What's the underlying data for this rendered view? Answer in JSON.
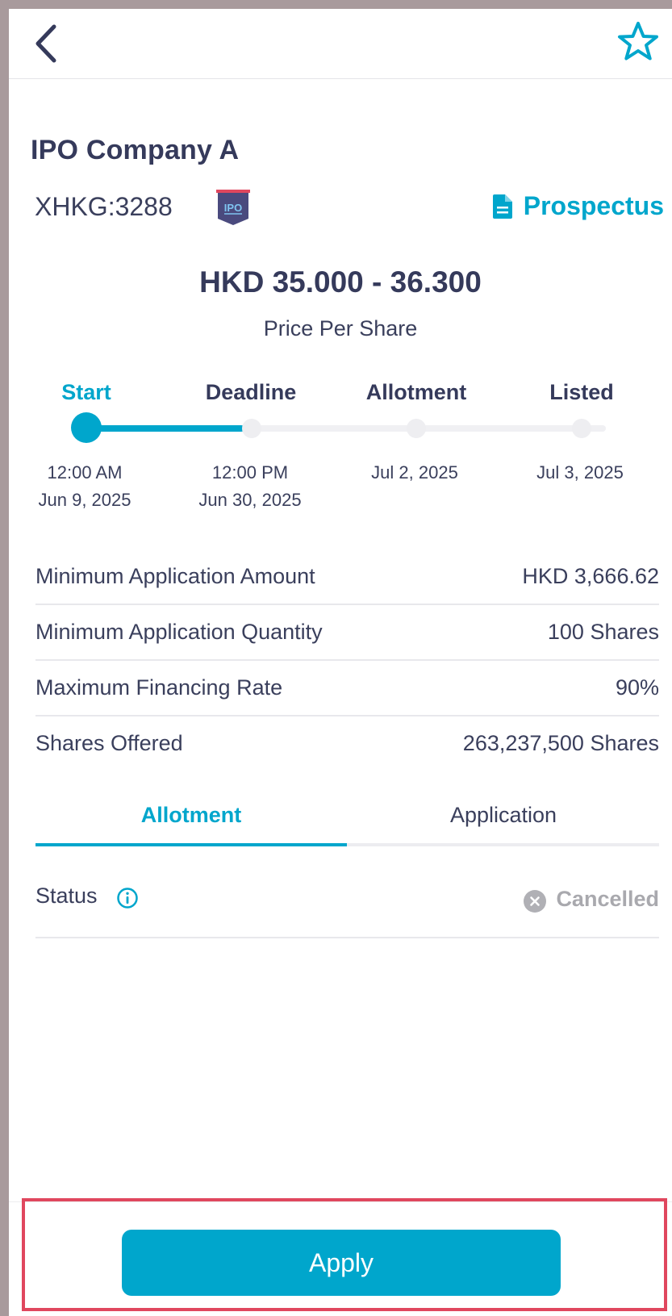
{
  "header": {
    "back_icon": "chevron-left-icon",
    "favorite_icon": "star-outline-icon"
  },
  "company": {
    "name": "IPO Company A",
    "ticker": "XHKG:3288",
    "badge_text": "IPO",
    "prospectus_label": "Prospectus"
  },
  "price": {
    "range": "HKD 35.000 - 36.300",
    "caption": "Price Per Share"
  },
  "timeline": {
    "steps": [
      {
        "label": "Start",
        "time": "12:00 AM",
        "date": "Jun 9, 2025"
      },
      {
        "label": "Deadline",
        "time": "12:00 PM",
        "date": "Jun 30, 2025"
      },
      {
        "label": "Allotment",
        "time": "",
        "date": "Jul 2, 2025"
      },
      {
        "label": "Listed",
        "time": "",
        "date": "Jul 3, 2025"
      }
    ]
  },
  "details": [
    {
      "label": "Minimum Application Amount",
      "value": "HKD 3,666.62"
    },
    {
      "label": "Minimum Application Quantity",
      "value": "100 Shares"
    },
    {
      "label": "Maximum Financing Rate",
      "value": "90%"
    },
    {
      "label": "Shares Offered",
      "value": "263,237,500 Shares"
    }
  ],
  "tabs": [
    {
      "label": "Allotment"
    },
    {
      "label": "Application"
    }
  ],
  "status": {
    "label": "Status",
    "value": "Cancelled"
  },
  "footer": {
    "apply_label": "Apply"
  },
  "colors": {
    "accent": "#00a6cc",
    "text": "#3a3f5c",
    "muted": "#a9a9ae",
    "highlight": "#e0475e"
  }
}
